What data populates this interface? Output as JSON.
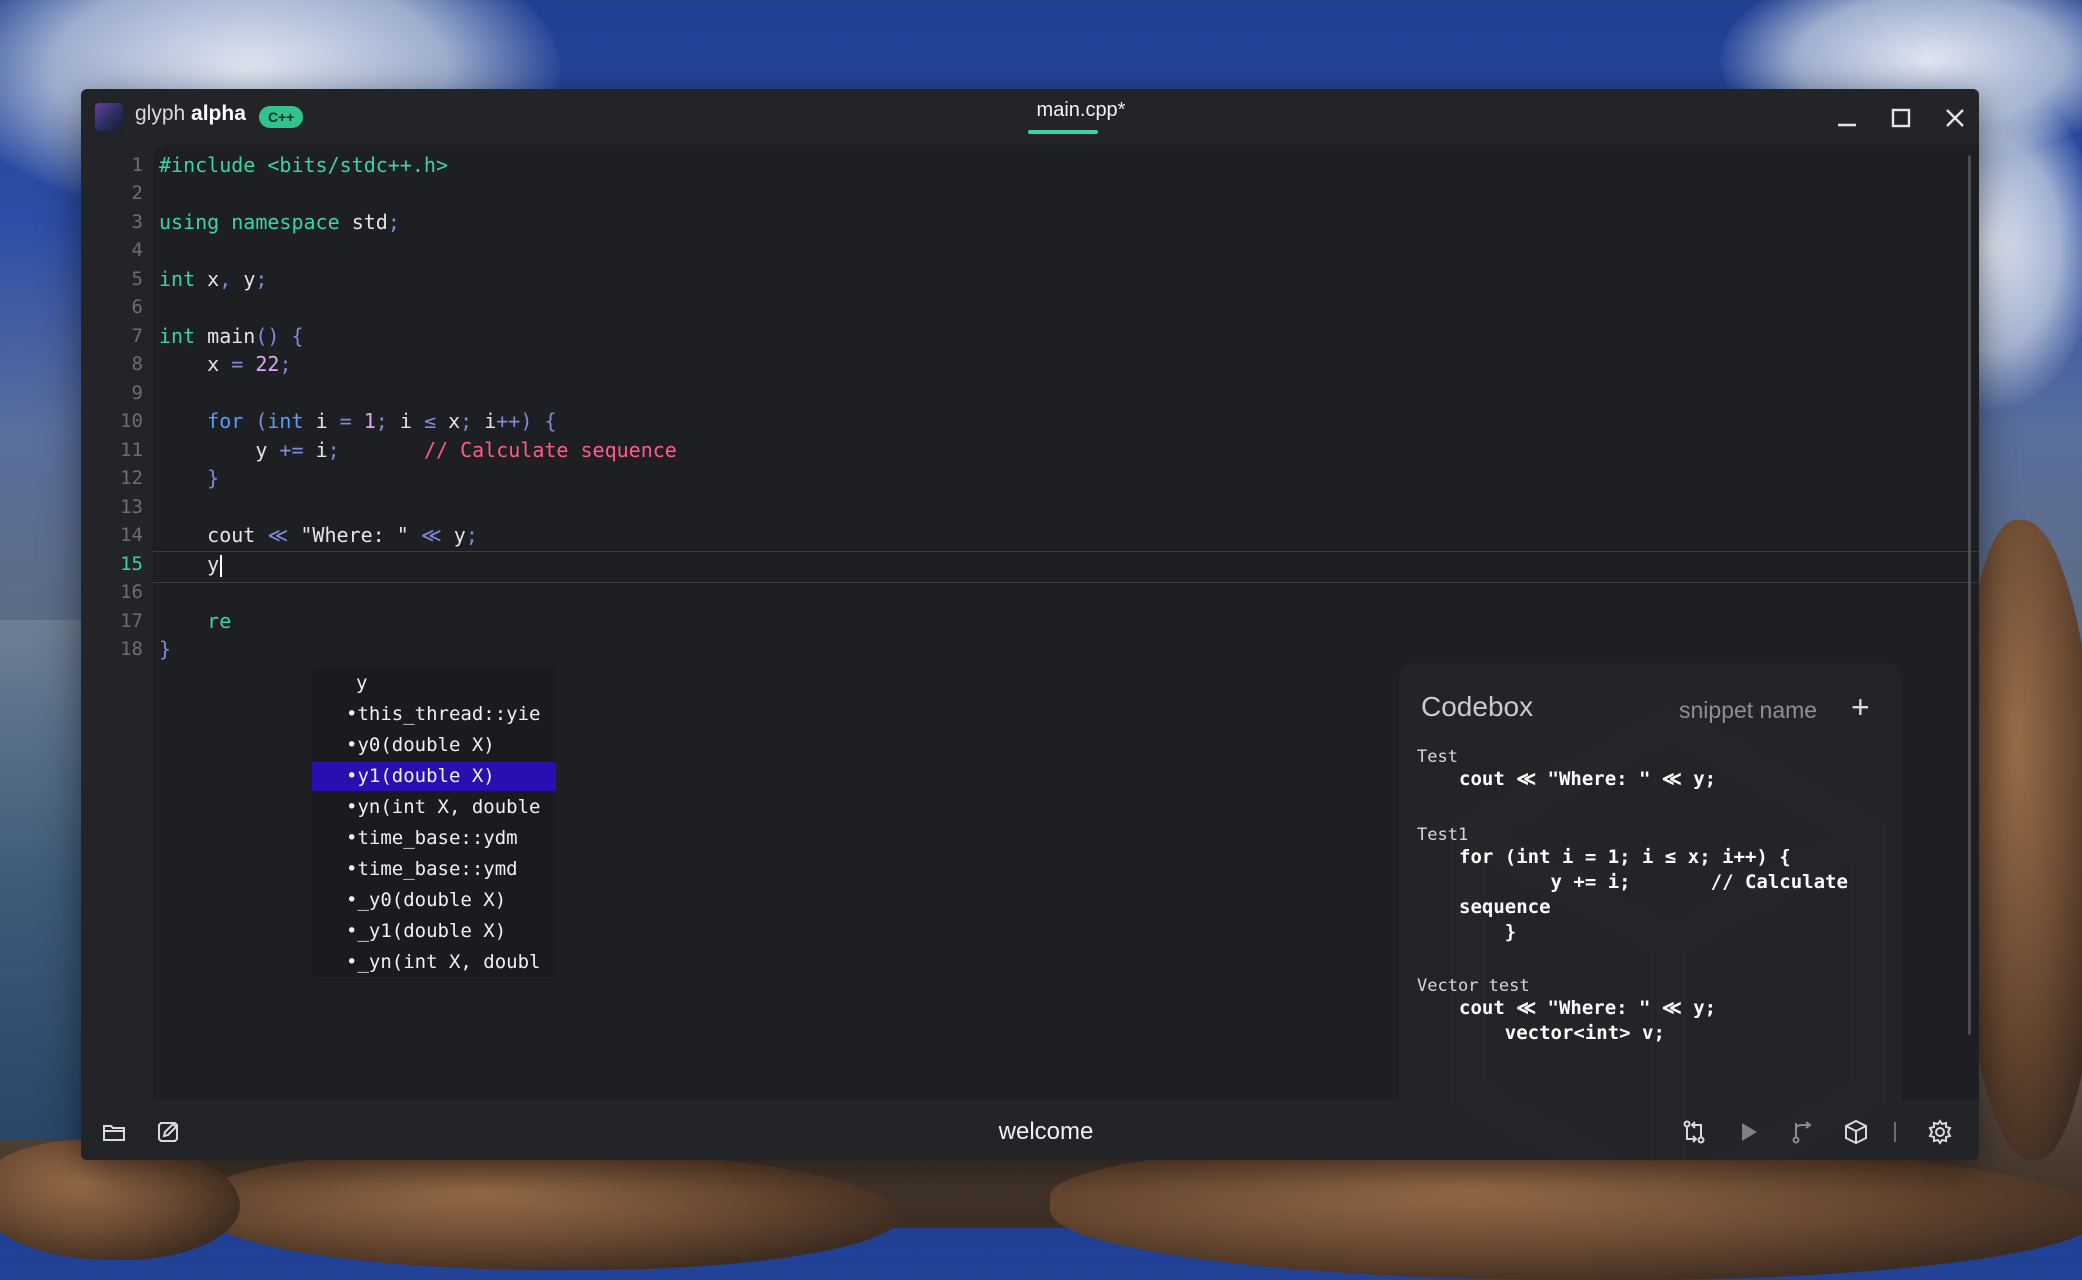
{
  "app": {
    "name_light": "glyph",
    "name_bold": "alpha",
    "language_badge": "C++"
  },
  "tab": {
    "title": "main.cpp*"
  },
  "window_controls": {
    "minimize_icon": "minimize-icon",
    "maximize_icon": "maximize-icon",
    "close_icon": "close-icon"
  },
  "editor": {
    "active_line": 15,
    "line_numbers": [
      "1",
      "2",
      "3",
      "4",
      "5",
      "6",
      "7",
      "8",
      "9",
      "10",
      "11",
      "12",
      "13",
      "14",
      "15",
      "16",
      "17",
      "18"
    ],
    "lines": [
      "#include <bits/stdc++.h>",
      "",
      "using namespace std;",
      "",
      "int x, y;",
      "",
      "int main() {",
      "    x = 22;",
      "",
      "    for (int i = 1; i ≤ x; i++) {",
      "        y += i;       // Calculate sequence",
      "    }",
      "",
      "    cout ≪ \"Where: \" ≪ y;",
      "    y",
      "",
      "    re",
      "}"
    ]
  },
  "autocomplete": {
    "selected_index": 3,
    "items": [
      "y",
      "•this_thread::yie",
      "•y0(double X)",
      "•y1(double X)",
      "•yn(int X, double",
      "•time_base::ydm",
      "•time_base::ymd",
      "•_y0(double X)",
      "•_y1(double X)",
      "•_yn(int X, doubl"
    ]
  },
  "codebox": {
    "title": "Codebox",
    "snippet_name_placeholder": "snippet name",
    "add_label": "+",
    "snippets": [
      {
        "name": "Test",
        "code": "cout ≪ \"Where: \" ≪ y;"
      },
      {
        "name": "Test1",
        "code": "for (int i = 1; i ≤ x; i++) {\n        y += i;       // Calculate\nsequence\n    }"
      },
      {
        "name": "Vector test",
        "code": "cout ≪ \"Where: \" ≪ y;\n    vector<int> v;"
      }
    ]
  },
  "statusbar": {
    "welcome": "welcome",
    "left_icons": [
      "folder-icon",
      "edit-icon"
    ],
    "right_icons": [
      "compare-icon",
      "run-icon",
      "branch-icon",
      "package-icon",
      "settings-icon"
    ]
  },
  "colors": {
    "accent": "#3ed3a6",
    "selection": "#2a0fb0",
    "comment": "#ff5c8a",
    "keyword_blue": "#5a9cff"
  }
}
